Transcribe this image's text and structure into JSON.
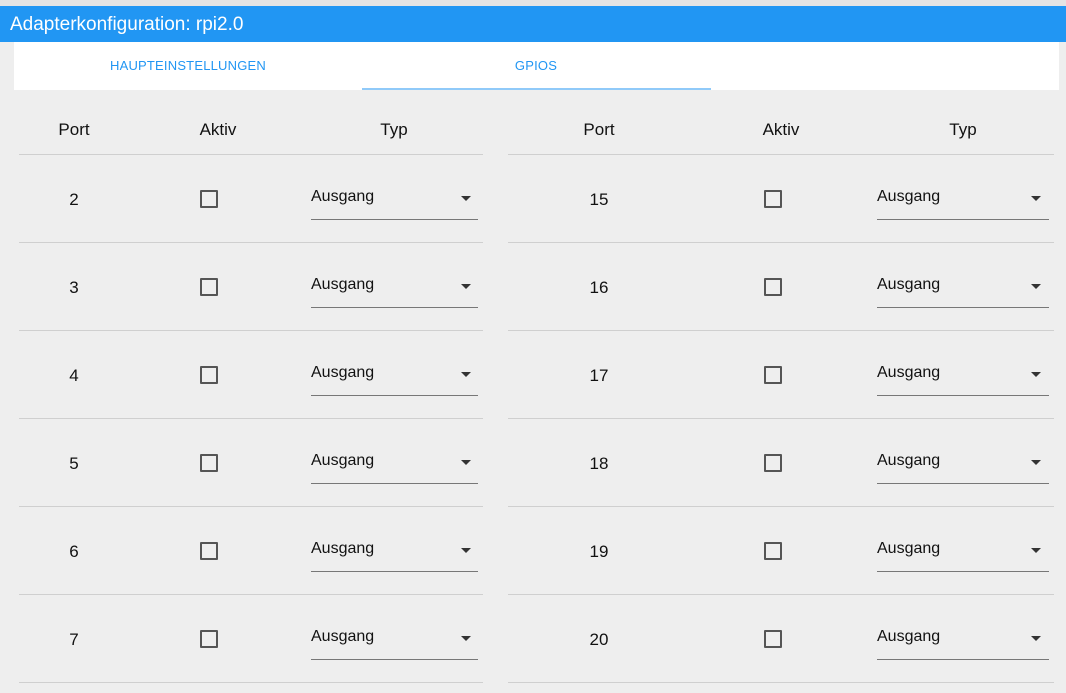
{
  "window": {
    "title": "Adapterkonfiguration: rpi2.0"
  },
  "tabs": [
    {
      "label": "HAUPTEINSTELLUNGEN",
      "active": false
    },
    {
      "label": "GPIOS",
      "active": true
    }
  ],
  "colors": {
    "accent": "#2196f3",
    "background": "#eeeeee",
    "tab_indicator": "#90caf9"
  },
  "table_left": {
    "headers": {
      "port": "Port",
      "aktiv": "Aktiv",
      "typ": "Typ"
    },
    "rows": [
      {
        "port": "2",
        "active": false,
        "type": "Ausgang"
      },
      {
        "port": "3",
        "active": false,
        "type": "Ausgang"
      },
      {
        "port": "4",
        "active": false,
        "type": "Ausgang"
      },
      {
        "port": "5",
        "active": false,
        "type": "Ausgang"
      },
      {
        "port": "6",
        "active": false,
        "type": "Ausgang"
      },
      {
        "port": "7",
        "active": false,
        "type": "Ausgang"
      }
    ]
  },
  "table_right": {
    "headers": {
      "port": "Port",
      "aktiv": "Aktiv",
      "typ": "Typ"
    },
    "rows": [
      {
        "port": "15",
        "active": false,
        "type": "Ausgang"
      },
      {
        "port": "16",
        "active": false,
        "type": "Ausgang"
      },
      {
        "port": "17",
        "active": false,
        "type": "Ausgang"
      },
      {
        "port": "18",
        "active": false,
        "type": "Ausgang"
      },
      {
        "port": "19",
        "active": false,
        "type": "Ausgang"
      },
      {
        "port": "20",
        "active": false,
        "type": "Ausgang"
      }
    ]
  },
  "icons": {
    "dropdown": "chevron-down-icon",
    "checkbox": "checkbox-unchecked-icon"
  }
}
